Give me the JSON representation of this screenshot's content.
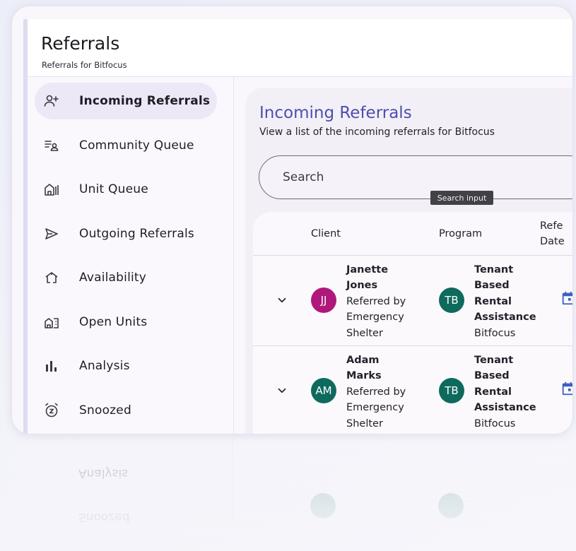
{
  "app": {
    "title": "Referrals",
    "subtitle": "Referrals for Bitfocus"
  },
  "sidebar": {
    "items": [
      {
        "label": "Incoming Referrals",
        "icon": "person-add-icon",
        "active": true
      },
      {
        "label": "Community Queue",
        "icon": "queue-person-icon",
        "active": false
      },
      {
        "label": "Unit Queue",
        "icon": "house-queue-icon",
        "active": false
      },
      {
        "label": "Outgoing Referrals",
        "icon": "send-icon",
        "active": false
      },
      {
        "label": "Availability",
        "icon": "availability-house-icon",
        "active": false
      },
      {
        "label": "Open Units",
        "icon": "open-units-icon",
        "active": false
      },
      {
        "label": "Analysis",
        "icon": "bar-chart-icon",
        "active": false
      },
      {
        "label": "Snoozed",
        "icon": "snooze-clock-icon",
        "active": false
      }
    ]
  },
  "main": {
    "title": "Incoming Referrals",
    "description": "View a list of the incoming referrals for Bitfocus",
    "search": {
      "placeholder": "Search",
      "tooltip": "Search input"
    },
    "table": {
      "columns": [
        "Client",
        "Program",
        "Refe",
        "Date"
      ],
      "rows": [
        {
          "initials": "JJ",
          "avatar_color": "#b0177a",
          "client_name_1": "Janette",
          "client_name_2": "Jones",
          "referred_1": "Referred by",
          "referred_2": "Emergency",
          "referred_3": "Shelter",
          "program_initials": "TB",
          "program_color": "#0e6a5c",
          "program_1": "Tenant",
          "program_2": "Based",
          "program_3": "Rental",
          "program_4": "Assistance",
          "program_org": "Bitfocus"
        },
        {
          "initials": "AM",
          "avatar_color": "#0e6a5c",
          "client_name_1": "Adam",
          "client_name_2": "Marks",
          "referred_1": "Referred by",
          "referred_2": "Emergency",
          "referred_3": "Shelter",
          "program_initials": "TB",
          "program_color": "#0e6a5c",
          "program_1": "Tenant",
          "program_2": "Based",
          "program_3": "Rental",
          "program_4": "Assistance",
          "program_org": "Bitfocus"
        }
      ]
    }
  },
  "colors": {
    "accent": "#4b4fae",
    "calendar_icon": "#3b5fc2",
    "active_nav": "#ece8f6"
  }
}
